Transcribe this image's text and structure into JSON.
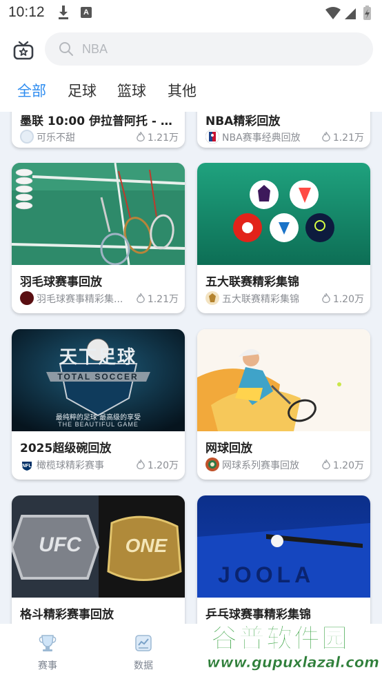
{
  "status_bar": {
    "time": "10:12"
  },
  "search": {
    "placeholder": "NBA"
  },
  "tabs": [
    {
      "label": "全部",
      "active": true
    },
    {
      "label": "足球",
      "active": false
    },
    {
      "label": "篮球",
      "active": false
    },
    {
      "label": "其他",
      "active": false
    }
  ],
  "cards": [
    {
      "title": "墨联 10:00 伊拉普阿托 - 阿...",
      "author": "可乐不甜",
      "views": "1.21万"
    },
    {
      "title": "NBA精彩回放",
      "author": "NBA赛事经典回放",
      "views": "1.21万"
    },
    {
      "title": "羽毛球赛事回放",
      "author": "羽毛球赛事精彩集...",
      "views": "1.21万"
    },
    {
      "title": "五大联赛精彩集锦",
      "author": "五大联赛精彩集锦",
      "views": "1.20万"
    },
    {
      "title": "2025超级碗回放",
      "author": "橄榄球精彩赛事",
      "views": "1.20万"
    },
    {
      "title": "网球回放",
      "author": "网球系列赛事回放",
      "views": "1.20万"
    },
    {
      "title": "格斗精彩赛事回放",
      "author": "",
      "views": ""
    },
    {
      "title": "乒乓球赛事精彩集锦",
      "author": "",
      "views": ""
    }
  ],
  "thumb_text": {
    "soccer_title": "天下足球",
    "soccer_sub": "TOTAL SOCCER",
    "soccer_line1": "最纯粹的足球  最高级的享受",
    "soccer_line2": "THE BEAUTIFUL GAME",
    "ufc": "UFC",
    "one": "ONE",
    "joola": "JOOLA"
  },
  "bottom_nav": [
    {
      "label": "赛事",
      "icon": "trophy-icon"
    },
    {
      "label": "数据",
      "icon": "data-icon"
    }
  ],
  "watermark": {
    "title": "谷普软件园",
    "url": "www.gupuxlazal.com"
  },
  "colors": {
    "accent": "#2d8cf0",
    "background": "#eef2f8"
  }
}
